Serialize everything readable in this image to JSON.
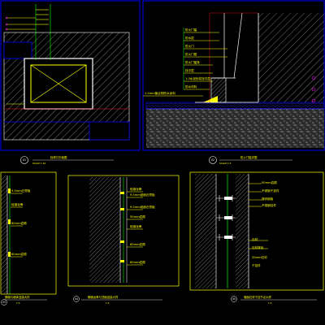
{
  "colors": {
    "background": "#000000",
    "frame": "#0000ff",
    "frame_inner": "#0000cc",
    "annotation": "#ffff00",
    "hatch": "#7a7a7a",
    "concrete": "#9a9a9a",
    "leader": "#00ff00",
    "panel": "#ffff00",
    "anchor": "#ffffff",
    "dimension": "#ff00ff",
    "accent_red": "#ff2020"
  },
  "panel_top_right": {
    "labels": [
      "防火门槛",
      "防水层",
      "防火门",
      "防火门框",
      "防火门槛条",
      "找平层",
      "1:3水泥砂浆找平层",
      "防水材料"
    ],
    "bottom_label": "1.5mm聚合物防水涂料",
    "title": "防火门槛详图",
    "scale": "SCALE 1:5",
    "number": "02"
  },
  "panel_top_left": {
    "title": "检修口平面图",
    "scale": "SCALE 1:10",
    "number": "01"
  },
  "panel_bottom_left": {
    "labels": [
      "9.5mm石膏板",
      "轻钢龙骨",
      "60mm岩棉",
      "60mm岩棉"
    ],
    "title": "隔墙与墙体连接大样",
    "scale": "1:5",
    "number": "03"
  },
  "panel_bottom_middle": {
    "labels": [
      "轻钢龙骨",
      "9.5mm纸面石膏板",
      "9.5mm纸面石膏板",
      "50mm岩棉",
      "轻钢龙骨",
      "60mm岩棉",
      "60mm岩棉"
    ],
    "title": "隔墙龙骨与顶面连接大样",
    "scale": "1:5",
    "number": "04"
  },
  "panel_bottom_right": {
    "labels": [
      "50mm岩棉",
      "不锈钢干挂件",
      "镀锌钢板",
      "不锈钢挂件",
      "石材",
      "石材背栓",
      "20mm石材",
      "干挂件"
    ],
    "title": "墙面石材干挂节点大样",
    "scale": "1:5",
    "number": "05"
  }
}
